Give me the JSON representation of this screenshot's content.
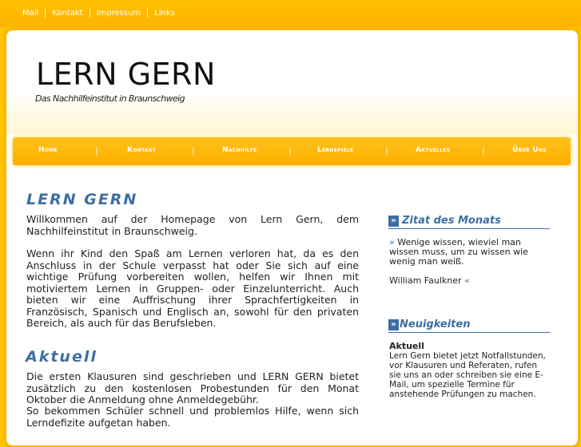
{
  "top_links": [
    "Mail",
    "Kontakt",
    "Impressum",
    "Links"
  ],
  "header": {
    "title": "LERN GERN",
    "subtitle": "Das Nachhilfeinstitut in Braunschweig"
  },
  "nav": [
    "Home",
    "Kontakt",
    "Nachhilfe",
    "Lernspiele",
    "Aktuelles",
    "Über Uns"
  ],
  "main": {
    "welcome_heading": "LERN GERN",
    "welcome_p1": "Willkommen auf der Homepage von Lern Gern, dem Nachhilfeinstitut in Braunschweig.",
    "welcome_p2": "Wenn ihr Kind den Spaß am Lernen verloren hat, da es den Anschluss in der Schule verpasst hat oder Sie sich auf eine wichtige Prüfung vorbereiten wollen, helfen wir Ihnen mit motiviertem Lernen in Gruppen- oder Einzelunterricht. Auch bieten wir eine Auffrischung ihrer Sprachfertigkeiten in Französisch, Spanisch und Englisch an, sowohl für den privaten Bereich, als auch für das Berufsleben.",
    "aktuell_heading": "Aktuell",
    "aktuell_p1": "Die ersten Klausuren sind geschrieben und LERN GERN bietet zusätzlich zu den kostenlosen Probestunden für den Monat Oktober die Anmeldung ohne Anmeldegebühr.",
    "aktuell_p2": "So bekommen Schüler schnell und problemlos Hilfe, wenn sich Lerndefizite aufgetan haben."
  },
  "sidebar": {
    "quote_heading": "Zitat des Monats",
    "quote_open": "»",
    "quote_text": "Wenige wissen, wieviel man wissen muss, um zu wissen wie wenig man weiß.",
    "quote_author": "William Faulkner",
    "quote_close": "«",
    "news_heading": "Neuigkeiten",
    "news_title": "Aktuell",
    "news_text": "Lern Gern bietet jetzt Notfallstunden, vor Klausuren und Referaten, rufen sie uns an oder schreiben sie eine E-Mail, um spezielle Termine für anstehende Prüfungen zu machen.",
    "heading_marker": "»"
  }
}
